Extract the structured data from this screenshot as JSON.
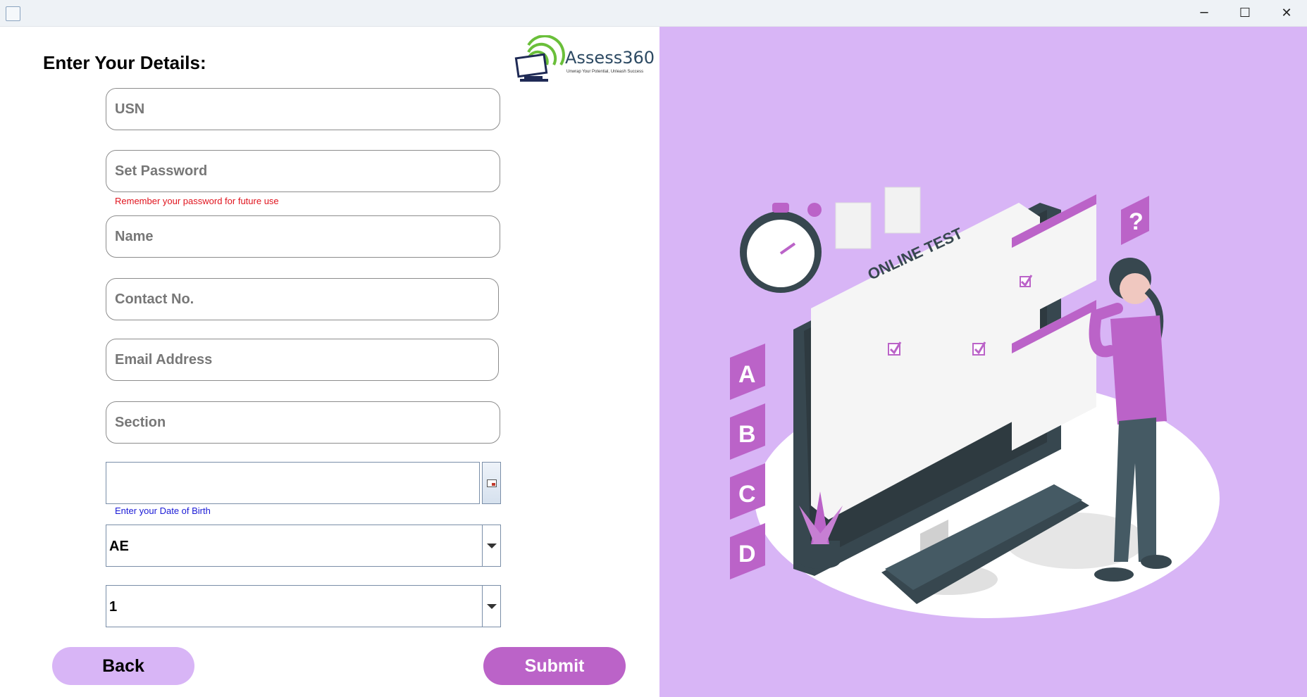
{
  "window": {
    "controls": {
      "minimize": "─",
      "maximize": "☐",
      "close": "✕"
    }
  },
  "form": {
    "heading": "Enter Your Details:",
    "fields": [
      {
        "placeholder": "USN"
      },
      {
        "placeholder": "Set Password"
      },
      {
        "placeholder": "Name"
      },
      {
        "placeholder": "Contact No."
      },
      {
        "placeholder": "Email Address"
      },
      {
        "placeholder": "Section"
      }
    ],
    "password_hint": "Remember your password for future use",
    "dob_hint": "Enter your Date of Birth",
    "selects": [
      {
        "value": "AE"
      },
      {
        "value": "1"
      }
    ],
    "back_label": "Back",
    "submit_label": "Submit"
  },
  "logo": {
    "name": "Assess360",
    "tagline": "Unwrap Your Potential, Unleash Success"
  },
  "illustration": {
    "screen_title": "ONLINE TEST",
    "letters": [
      "A",
      "B",
      "C",
      "D"
    ],
    "question_mark": "?",
    "options": [
      "A",
      "B",
      "C",
      "D"
    ]
  },
  "colors": {
    "panel_background": "#d8b5f6",
    "accent": "#bb63c8",
    "password_hint": "#e0141e",
    "dob_hint": "#1a1ad6"
  }
}
